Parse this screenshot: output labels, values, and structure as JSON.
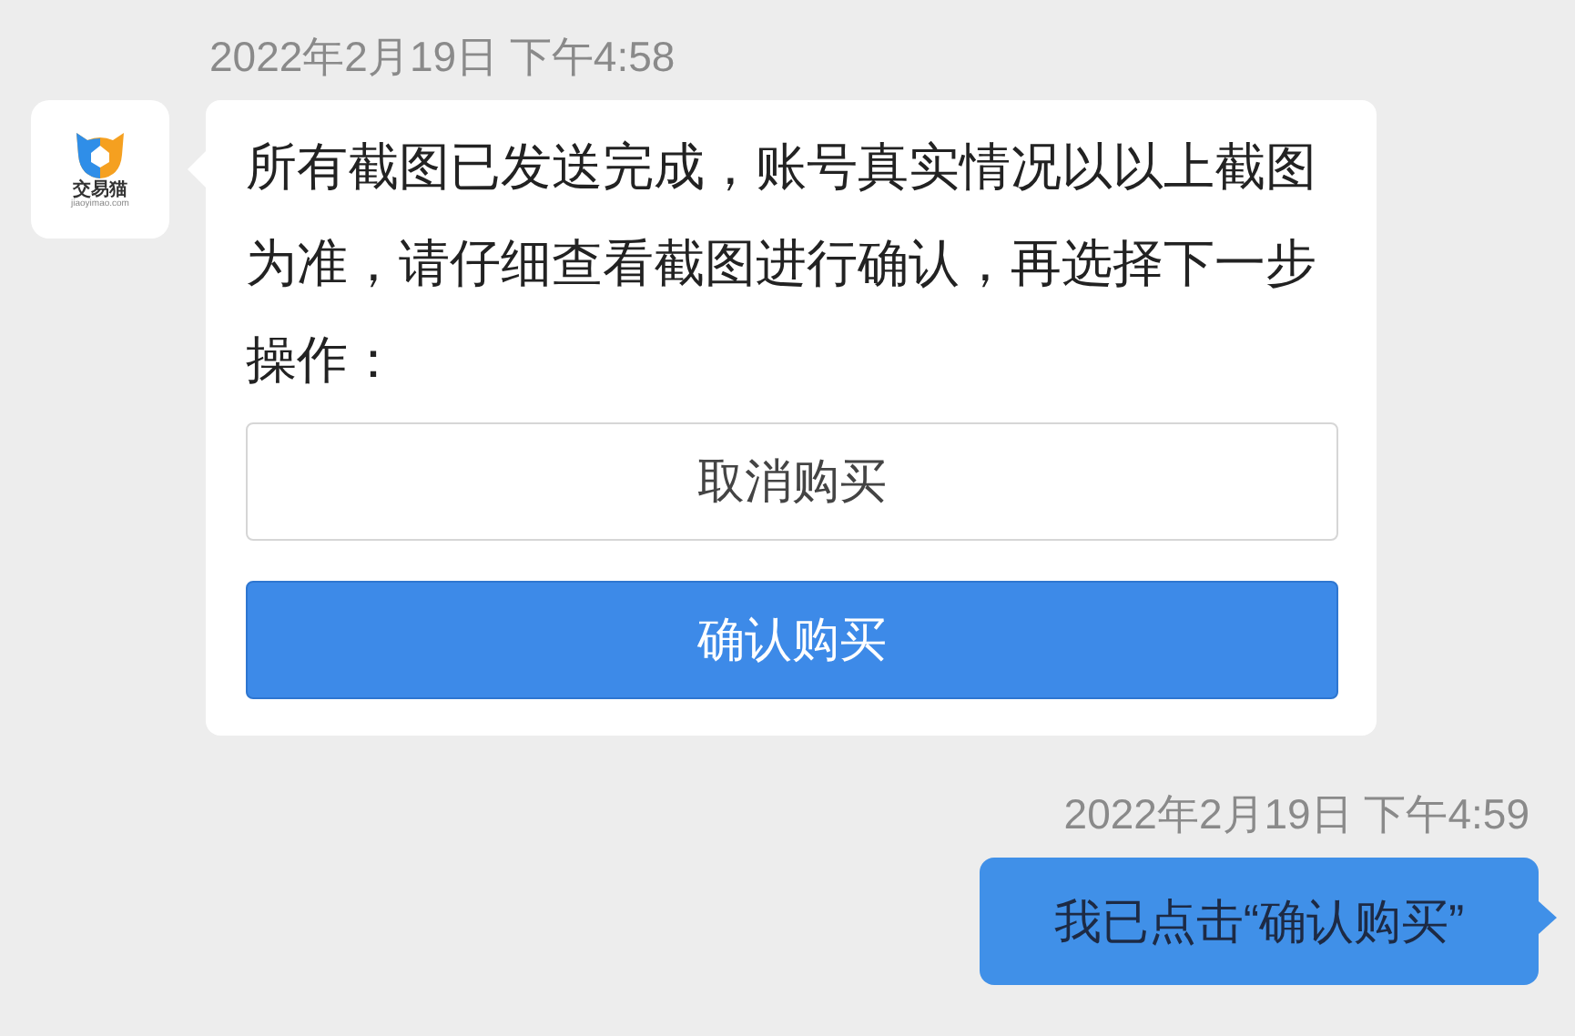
{
  "messages": [
    {
      "timestamp": "2022年2月19日 下午4:58",
      "kind": "received",
      "avatar": {
        "name": "交易猫",
        "domain": "jiaoyimao.com"
      },
      "text": "所有截图已发送完成，账号真实情况以以上截图为准，请仔细查看截图进行确认，再选择下一步操作：",
      "buttons": [
        {
          "label": "取消购买",
          "kind": "outline"
        },
        {
          "label": "确认购买",
          "kind": "primary"
        }
      ]
    },
    {
      "timestamp": "2022年2月19日 下午4:59",
      "kind": "sent",
      "text": "我已点击“确认购买”"
    }
  ]
}
